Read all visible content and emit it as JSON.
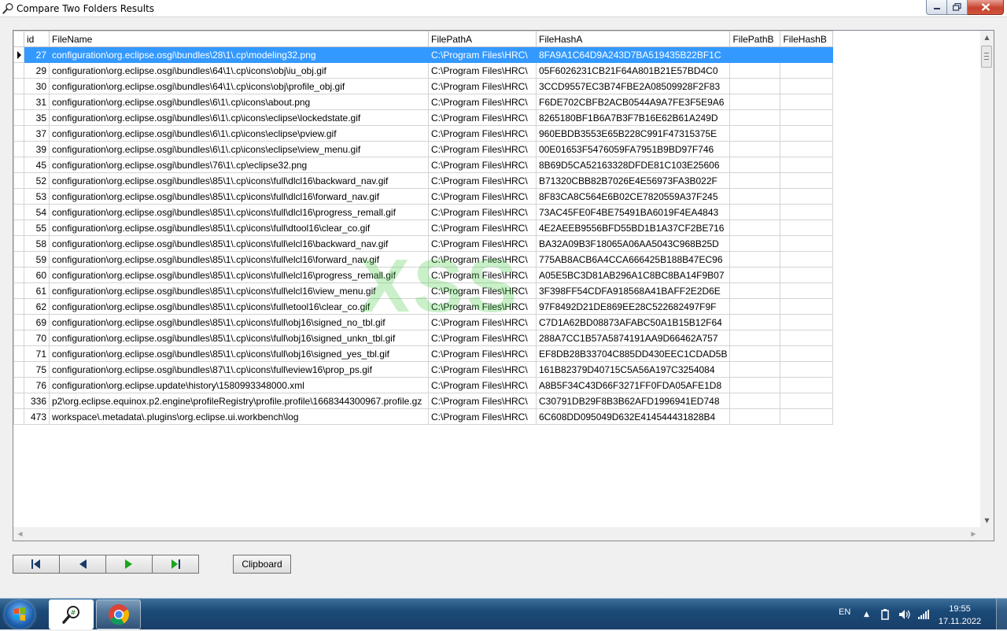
{
  "window": {
    "title": "Compare Two Folders Results",
    "icons": [
      "magnifier-icon",
      "minimize-icon",
      "maximize-icon",
      "close-icon"
    ]
  },
  "grid": {
    "columns": [
      "id",
      "FileName",
      "FilePathA",
      "FileHashA",
      "FilePathB",
      "FileHashB"
    ],
    "selected_row_index": 0,
    "rows": [
      {
        "id": "27",
        "FileName": "configuration\\org.eclipse.osgi\\bundles\\28\\1\\.cp\\modeling32.png",
        "FilePathA": "C:\\Program Files\\HRC\\",
        "FileHashA": "8FA9A1C64D9A243D7BA519435B22BF1C",
        "FilePathB": "",
        "FileHashB": ""
      },
      {
        "id": "29",
        "FileName": "configuration\\org.eclipse.osgi\\bundles\\64\\1\\.cp\\icons\\obj\\iu_obj.gif",
        "FilePathA": "C:\\Program Files\\HRC\\",
        "FileHashA": "05F6026231CB21F64A801B21E57BD4C0",
        "FilePathB": "",
        "FileHashB": ""
      },
      {
        "id": "30",
        "FileName": "configuration\\org.eclipse.osgi\\bundles\\64\\1\\.cp\\icons\\obj\\profile_obj.gif",
        "FilePathA": "C:\\Program Files\\HRC\\",
        "FileHashA": "3CCD9557EC3B74FBE2A08509928F2F83",
        "FilePathB": "",
        "FileHashB": ""
      },
      {
        "id": "31",
        "FileName": "configuration\\org.eclipse.osgi\\bundles\\6\\1\\.cp\\icons\\about.png",
        "FilePathA": "C:\\Program Files\\HRC\\",
        "FileHashA": "F6DE702CBFB2ACB0544A9A7FE3F5E9A6",
        "FilePathB": "",
        "FileHashB": ""
      },
      {
        "id": "35",
        "FileName": "configuration\\org.eclipse.osgi\\bundles\\6\\1\\.cp\\icons\\eclipse\\lockedstate.gif",
        "FilePathA": "C:\\Program Files\\HRC\\",
        "FileHashA": "8265180BF1B6A7B3F7B16E62B61A249D",
        "FilePathB": "",
        "FileHashB": ""
      },
      {
        "id": "37",
        "FileName": "configuration\\org.eclipse.osgi\\bundles\\6\\1\\.cp\\icons\\eclipse\\pview.gif",
        "FilePathA": "C:\\Program Files\\HRC\\",
        "FileHashA": "960EBDB3553E65B228C991F47315375E",
        "FilePathB": "",
        "FileHashB": ""
      },
      {
        "id": "39",
        "FileName": "configuration\\org.eclipse.osgi\\bundles\\6\\1\\.cp\\icons\\eclipse\\view_menu.gif",
        "FilePathA": "C:\\Program Files\\HRC\\",
        "FileHashA": "00E01653F5476059FA7951B9BD97F746",
        "FilePathB": "",
        "FileHashB": ""
      },
      {
        "id": "45",
        "FileName": "configuration\\org.eclipse.osgi\\bundles\\76\\1\\.cp\\eclipse32.png",
        "FilePathA": "C:\\Program Files\\HRC\\",
        "FileHashA": "8B69D5CA52163328DFDE81C103E25606",
        "FilePathB": "",
        "FileHashB": ""
      },
      {
        "id": "52",
        "FileName": "configuration\\org.eclipse.osgi\\bundles\\85\\1\\.cp\\icons\\full\\dlcl16\\backward_nav.gif",
        "FilePathA": "C:\\Program Files\\HRC\\",
        "FileHashA": "B71320CBB82B7026E4E56973FA3B022F",
        "FilePathB": "",
        "FileHashB": ""
      },
      {
        "id": "53",
        "FileName": "configuration\\org.eclipse.osgi\\bundles\\85\\1\\.cp\\icons\\full\\dlcl16\\forward_nav.gif",
        "FilePathA": "C:\\Program Files\\HRC\\",
        "FileHashA": "8F83CA8C564E6B02CE7820559A37F245",
        "FilePathB": "",
        "FileHashB": ""
      },
      {
        "id": "54",
        "FileName": "configuration\\org.eclipse.osgi\\bundles\\85\\1\\.cp\\icons\\full\\dlcl16\\progress_remall.gif",
        "FilePathA": "C:\\Program Files\\HRC\\",
        "FileHashA": "73AC45FE0F4BE75491BA6019F4EA4843",
        "FilePathB": "",
        "FileHashB": ""
      },
      {
        "id": "55",
        "FileName": "configuration\\org.eclipse.osgi\\bundles\\85\\1\\.cp\\icons\\full\\dtool16\\clear_co.gif",
        "FilePathA": "C:\\Program Files\\HRC\\",
        "FileHashA": "4E2AEEB9556BFD55BD1B1A37CF2BE716",
        "FilePathB": "",
        "FileHashB": ""
      },
      {
        "id": "58",
        "FileName": "configuration\\org.eclipse.osgi\\bundles\\85\\1\\.cp\\icons\\full\\elcl16\\backward_nav.gif",
        "FilePathA": "C:\\Program Files\\HRC\\",
        "FileHashA": "BA32A09B3F18065A06AA5043C968B25D",
        "FilePathB": "",
        "FileHashB": ""
      },
      {
        "id": "59",
        "FileName": "configuration\\org.eclipse.osgi\\bundles\\85\\1\\.cp\\icons\\full\\elcl16\\forward_nav.gif",
        "FilePathA": "C:\\Program Files\\HRC\\",
        "FileHashA": "775AB8ACB6A4CCA666425B188B47EC96",
        "FilePathB": "",
        "FileHashB": ""
      },
      {
        "id": "60",
        "FileName": "configuration\\org.eclipse.osgi\\bundles\\85\\1\\.cp\\icons\\full\\elcl16\\progress_remall.gif",
        "FilePathA": "C:\\Program Files\\HRC\\",
        "FileHashA": "A05E5BC3D81AB296A1C8BC8BA14F9B07",
        "FilePathB": "",
        "FileHashB": ""
      },
      {
        "id": "61",
        "FileName": "configuration\\org.eclipse.osgi\\bundles\\85\\1\\.cp\\icons\\full\\elcl16\\view_menu.gif",
        "FilePathA": "C:\\Program Files\\HRC\\",
        "FileHashA": "3F398FF54CDFA918568A41BAFF2E2D6E",
        "FilePathB": "",
        "FileHashB": ""
      },
      {
        "id": "62",
        "FileName": "configuration\\org.eclipse.osgi\\bundles\\85\\1\\.cp\\icons\\full\\etool16\\clear_co.gif",
        "FilePathA": "C:\\Program Files\\HRC\\",
        "FileHashA": "97F8492D21DE869EE28C522682497F9F",
        "FilePathB": "",
        "FileHashB": ""
      },
      {
        "id": "69",
        "FileName": "configuration\\org.eclipse.osgi\\bundles\\85\\1\\.cp\\icons\\full\\obj16\\signed_no_tbl.gif",
        "FilePathA": "C:\\Program Files\\HRC\\",
        "FileHashA": "C7D1A62BD08873AFABC50A1B15B12F64",
        "FilePathB": "",
        "FileHashB": ""
      },
      {
        "id": "70",
        "FileName": "configuration\\org.eclipse.osgi\\bundles\\85\\1\\.cp\\icons\\full\\obj16\\signed_unkn_tbl.gif",
        "FilePathA": "C:\\Program Files\\HRC\\",
        "FileHashA": "288A7CC1B57A5874191AA9D66462A757",
        "FilePathB": "",
        "FileHashB": ""
      },
      {
        "id": "71",
        "FileName": "configuration\\org.eclipse.osgi\\bundles\\85\\1\\.cp\\icons\\full\\obj16\\signed_yes_tbl.gif",
        "FilePathA": "C:\\Program Files\\HRC\\",
        "FileHashA": "EF8DB28B33704C885DD430EEC1CDAD5B",
        "FilePathB": "",
        "FileHashB": ""
      },
      {
        "id": "75",
        "FileName": "configuration\\org.eclipse.osgi\\bundles\\87\\1\\.cp\\icons\\full\\eview16\\prop_ps.gif",
        "FilePathA": "C:\\Program Files\\HRC\\",
        "FileHashA": "161B82379D40715C5A56A197C3254084",
        "FilePathB": "",
        "FileHashB": ""
      },
      {
        "id": "76",
        "FileName": "configuration\\org.eclipse.update\\history\\1580993348000.xml",
        "FilePathA": "C:\\Program Files\\HRC\\",
        "FileHashA": "A8B5F34C43D66F3271FF0FDA05AFE1D8",
        "FilePathB": "",
        "FileHashB": ""
      },
      {
        "id": "336",
        "FileName": "p2\\org.eclipse.equinox.p2.engine\\profileRegistry\\profile.profile\\1668344300967.profile.gz",
        "FilePathA": "C:\\Program Files\\HRC\\",
        "FileHashA": "C30791DB29F8B3B62AFD1996941ED748",
        "FilePathB": "",
        "FileHashB": ""
      },
      {
        "id": "473",
        "FileName": "workspace\\.metadata\\.plugins\\org.eclipse.ui.workbench\\log",
        "FilePathA": "C:\\Program Files\\HRC\\",
        "FileHashA": "6C608DD095049D632E414544431828B4",
        "FilePathB": "",
        "FileHashB": ""
      }
    ]
  },
  "watermark": "XSS",
  "navigation": {
    "icons": [
      "first-record-icon",
      "previous-record-icon",
      "next-record-icon",
      "last-record-icon"
    ],
    "clipboard_label": "Clipboard"
  },
  "taskbar": {
    "language": "EN",
    "time": "19:55",
    "date": "17.11.2022",
    "items": [
      "start-orb-icon",
      "magnifier-app-icon",
      "chrome-icon"
    ]
  },
  "colors": {
    "selection": "#3399ff",
    "watermark": "#3cc83c",
    "play_green": "#1aa51a",
    "taskbar": "#1b4a78"
  }
}
